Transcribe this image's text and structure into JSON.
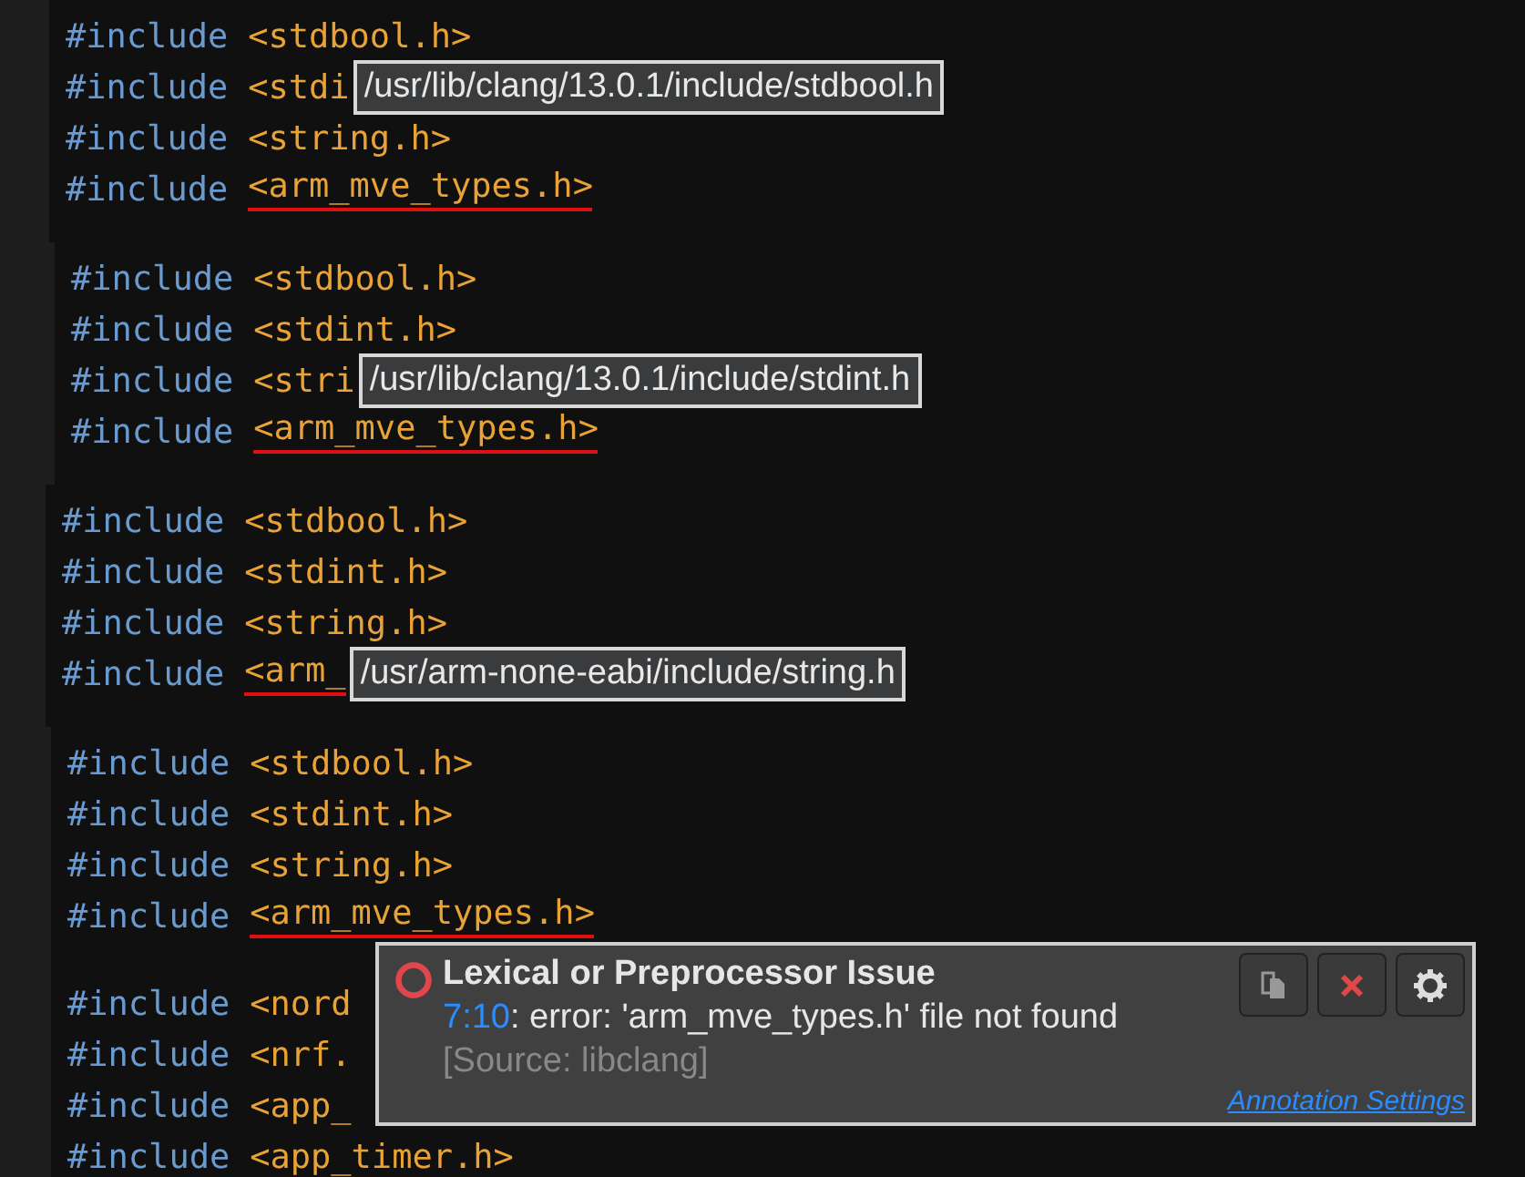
{
  "snippets": [
    {
      "lines": [
        {
          "kind": "code",
          "directive": "#include",
          "path": "<stdbool.h>",
          "error": false
        },
        {
          "kind": "code",
          "directive": "#include",
          "path": "<stdi",
          "error": false,
          "tooltip": "/usr/lib/clang/13.0.1/include/stdbool.h"
        },
        {
          "kind": "code",
          "directive": "#include",
          "path": "<string.h>",
          "error": false
        },
        {
          "kind": "code",
          "directive": "#include",
          "path": "<arm_mve_types.h>",
          "error": true
        }
      ]
    },
    {
      "lines": [
        {
          "kind": "code",
          "directive": "#include",
          "path": "<stdbool.h>",
          "error": false
        },
        {
          "kind": "code",
          "directive": "#include",
          "path": "<stdint.h>",
          "error": false
        },
        {
          "kind": "code",
          "directive": "#include",
          "path": "<stri",
          "error": false,
          "tooltip": "/usr/lib/clang/13.0.1/include/stdint.h"
        },
        {
          "kind": "code",
          "directive": "#include",
          "path": "<arm_mve_types.h>",
          "error": true
        }
      ]
    },
    {
      "lines": [
        {
          "kind": "code",
          "directive": "#include",
          "path": "<stdbool.h>",
          "error": false
        },
        {
          "kind": "code",
          "directive": "#include",
          "path": "<stdint.h>",
          "error": false
        },
        {
          "kind": "code",
          "directive": "#include",
          "path": "<string.h>",
          "error": false
        },
        {
          "kind": "code",
          "directive": "#include",
          "path": "<arm_",
          "error": true,
          "tooltip": "/usr/arm-none-eabi/include/string.h"
        }
      ]
    },
    {
      "lines": [
        {
          "kind": "code",
          "directive": "#include",
          "path": "<stdbool.h>",
          "error": false
        },
        {
          "kind": "code",
          "directive": "#include",
          "path": "<stdint.h>",
          "error": false
        },
        {
          "kind": "code",
          "directive": "#include",
          "path": "<string.h>",
          "error": false
        },
        {
          "kind": "code",
          "directive": "#include",
          "path": "<arm_mve_types.h>",
          "error": true
        },
        {
          "kind": "blank"
        },
        {
          "kind": "code",
          "directive": "#include",
          "path": "<nord",
          "error": false
        },
        {
          "kind": "code",
          "directive": "#include",
          "path": "<nrf.",
          "error": false
        },
        {
          "kind": "code",
          "directive": "#include",
          "path": "<app_",
          "error": false
        },
        {
          "kind": "code",
          "directive": "#include",
          "path": "<app_timer.h>",
          "error": false
        }
      ]
    }
  ],
  "diagnostic": {
    "title": "Lexical or Preprocessor Issue",
    "location": "7:10",
    "message": ": error: 'arm_mve_types.h' file not found",
    "source": "[Source: libclang]",
    "buttons": [
      {
        "kind": "copy"
      },
      {
        "kind": "close"
      },
      {
        "kind": "settings"
      }
    ],
    "link": "Annotation Settings"
  }
}
